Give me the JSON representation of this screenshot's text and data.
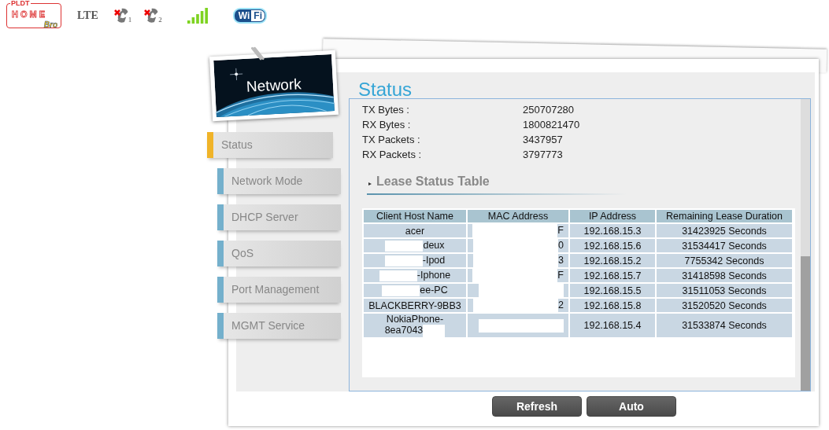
{
  "top_bar": {
    "logo": {
      "brand": "PLDT",
      "name": "HOME",
      "sub": "Bro"
    },
    "network_type": "LTE",
    "phone_lines": [
      {
        "number": "1",
        "connected": false
      },
      {
        "number": "2",
        "connected": false
      }
    ],
    "wifi_badge": [
      "Wi",
      "Fi"
    ]
  },
  "banner": {
    "title": "Network"
  },
  "sidebar": {
    "items": [
      {
        "label": "Status",
        "selected": true
      },
      {
        "label": "Network Mode",
        "selected": false
      },
      {
        "label": "DHCP Server",
        "selected": false
      },
      {
        "label": "QoS",
        "selected": false
      },
      {
        "label": "Port Management",
        "selected": false
      },
      {
        "label": "MGMT Service",
        "selected": false
      }
    ]
  },
  "page_title": "Status",
  "stats": [
    {
      "label": "TX Bytes :",
      "value": "250707280"
    },
    {
      "label": "RX Bytes :",
      "value": "1800821470"
    },
    {
      "label": "TX Packets :",
      "value": "3437957"
    },
    {
      "label": "RX Packets :",
      "value": "3797773"
    }
  ],
  "lease_table": {
    "title": "Lease Status Table",
    "columns": [
      "Client Host Name",
      "MAC Address",
      "IP Address",
      "Remaining Lease Duration"
    ],
    "rows": [
      {
        "host": "acer",
        "masked_start": false,
        "masked_end": false,
        "mac": "F",
        "ip": "192.168.15.3",
        "lease": "31423925 Seconds"
      },
      {
        "host": "deux",
        "masked_start": true,
        "masked_end": false,
        "mac": "0",
        "ip": "192.168.15.6",
        "lease": "31534417 Seconds"
      },
      {
        "host": "-Ipod",
        "masked_start": true,
        "masked_end": false,
        "mac": "3",
        "ip": "192.168.15.2",
        "lease": "7755342 Seconds"
      },
      {
        "host": "-Iphone",
        "masked_start": true,
        "masked_end": false,
        "mac": "F",
        "ip": "192.168.15.7",
        "lease": "31418598 Seconds"
      },
      {
        "host": "ee-PC",
        "masked_start": true,
        "masked_end": false,
        "ip": "192.168.15.5",
        "lease": "31511053 Seconds"
      },
      {
        "host": "BLACKBERRY-9BB3",
        "masked_start": false,
        "masked_end": false,
        "mac": "2",
        "ip": "192.168.15.8",
        "lease": "31520520 Seconds"
      },
      {
        "host": "NokiaPhone-8ea7043",
        "masked_start": false,
        "masked_end": true,
        "ip": "192.168.15.4",
        "lease": "31533874 Seconds"
      }
    ]
  },
  "buttons": [
    "Refresh",
    "Auto"
  ]
}
